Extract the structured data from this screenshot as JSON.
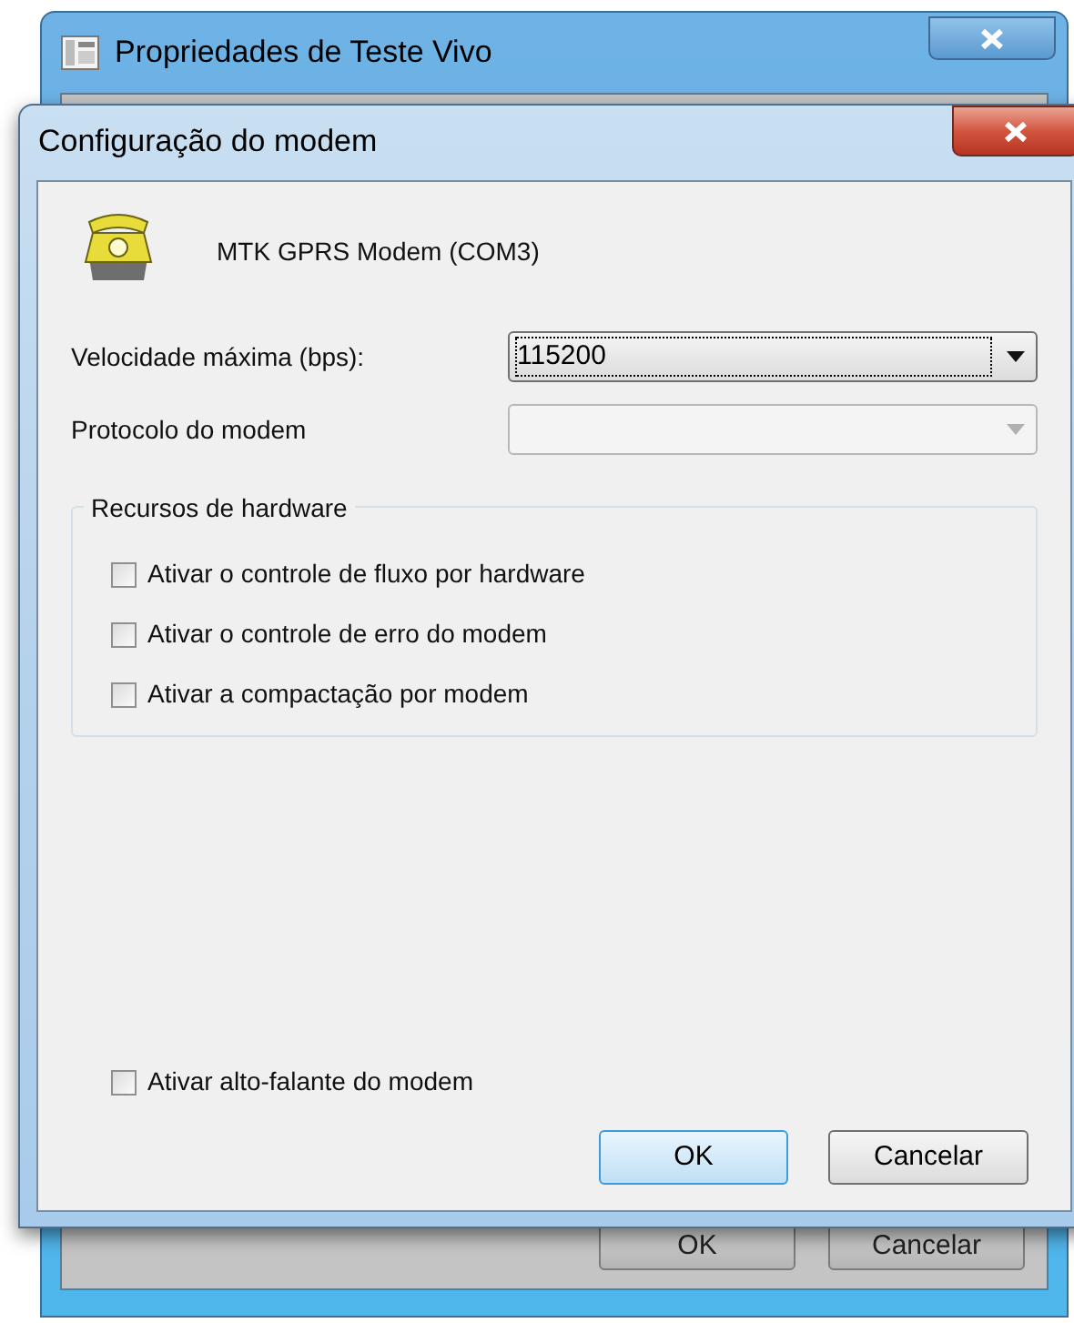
{
  "back_window": {
    "title": "Propriedades de Teste Vivo",
    "buttons": [
      {
        "label": "OK"
      },
      {
        "label": "Cancelar"
      }
    ]
  },
  "dialog": {
    "title": "Configuração do modem",
    "device": "MTK GPRS Modem (COM3)",
    "fields": [
      {
        "label": "Velocidade máxima (bps):",
        "value": "115200",
        "disabled": false
      },
      {
        "label": "Protocolo do modem",
        "disabled": true
      }
    ],
    "group": {
      "title": "Recursos de hardware",
      "options": [
        {
          "label": "Ativar o controle de fluxo por hardware",
          "checked": false
        },
        {
          "label": "Ativar o controle de erro do modem",
          "checked": false
        },
        {
          "label": "Ativar a compactação por modem",
          "checked": false
        }
      ]
    },
    "speaker": {
      "label": "Ativar alto-falante do modem",
      "checked": false
    },
    "buttons": [
      {
        "label": "OK",
        "default": true
      },
      {
        "label": "Cancelar",
        "default": false
      }
    ]
  }
}
